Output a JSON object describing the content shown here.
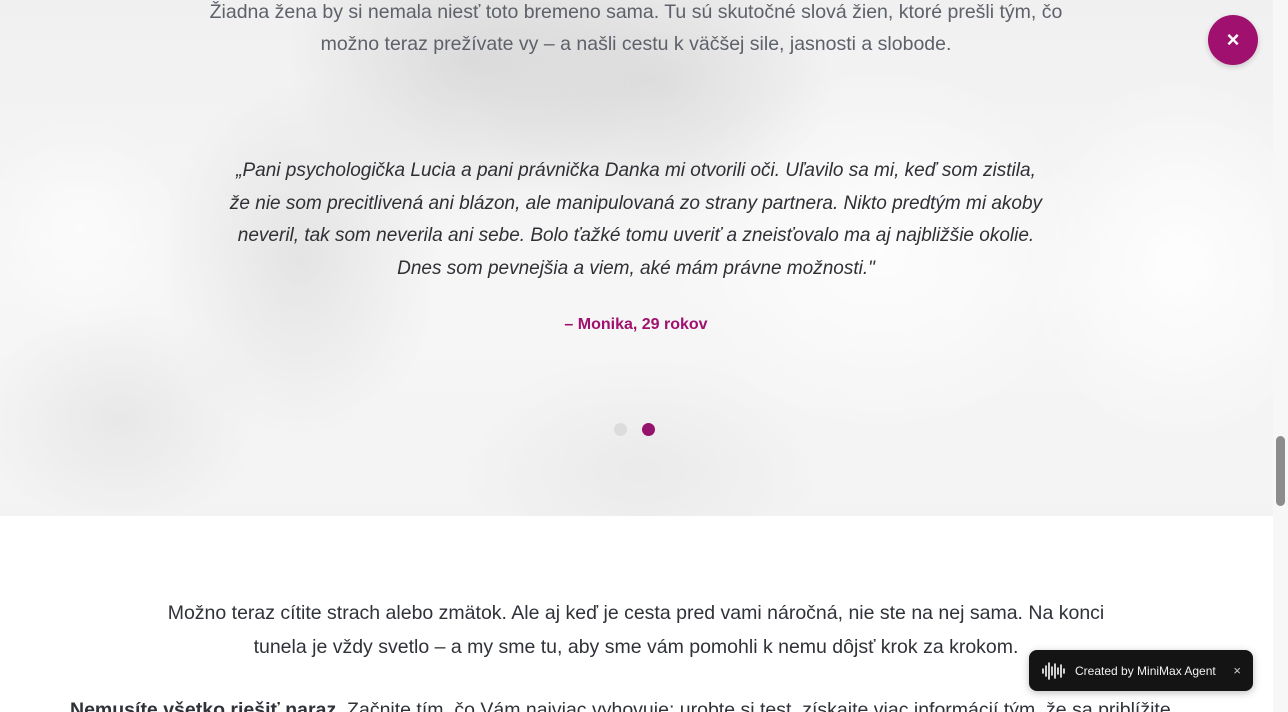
{
  "hero": {
    "intro": "Žiadna žena by si nemala niesť toto bremeno sama. Tu sú skutočné slová žien, ktoré prešli tým, čo možno teraz prežívate vy – a našli cestu k väčšej sile, jasnosti a slobode.",
    "quote": "„Pani psychologička Lucia a pani právnička Danka mi otvorili oči. Uľavilo sa mi, keď som zistila, že nie som precitlivená ani blázon, ale manipulovaná zo strany partnera. Nikto predtým mi akoby neveril, tak som neverila ani sebe. Bolo ťažké tomu uveriť a zneisťovalo ma aj najbližšie okolie. Dnes som pevnejšia a viem, aké mám právne možnosti.\"",
    "author": "– Monika, 29 rokov",
    "slides": {
      "count": 2,
      "active_index": 1
    }
  },
  "close_button": {
    "label": "×"
  },
  "lower": {
    "text": "Možno teraz cítite strach alebo zmätok. Ale aj keď je cesta pred vami náročná, nie ste na nej sama. Na konci tunela je vždy svetlo – a my sme tu, aby sme vám pomohli k nemu dôjsť krok za krokom.",
    "next_bold": "Nemusíte všetko riešiť naraz.",
    "next_rest": " Začnite tím, čo Vám najviac vyhovuje: urobte si test, získajte viac informácií tým, že sa priblížite"
  },
  "badge": {
    "label": "Created by MiniMax Agent",
    "close": "×",
    "icon": "sound-wave-icon"
  },
  "colors": {
    "accent": "#a0106e",
    "dot_active": "#96136d",
    "dot_inactive": "#dcdcdc",
    "body_text": "#2f3238",
    "muted_text": "#5d6169",
    "badge_bg": "#141414"
  }
}
